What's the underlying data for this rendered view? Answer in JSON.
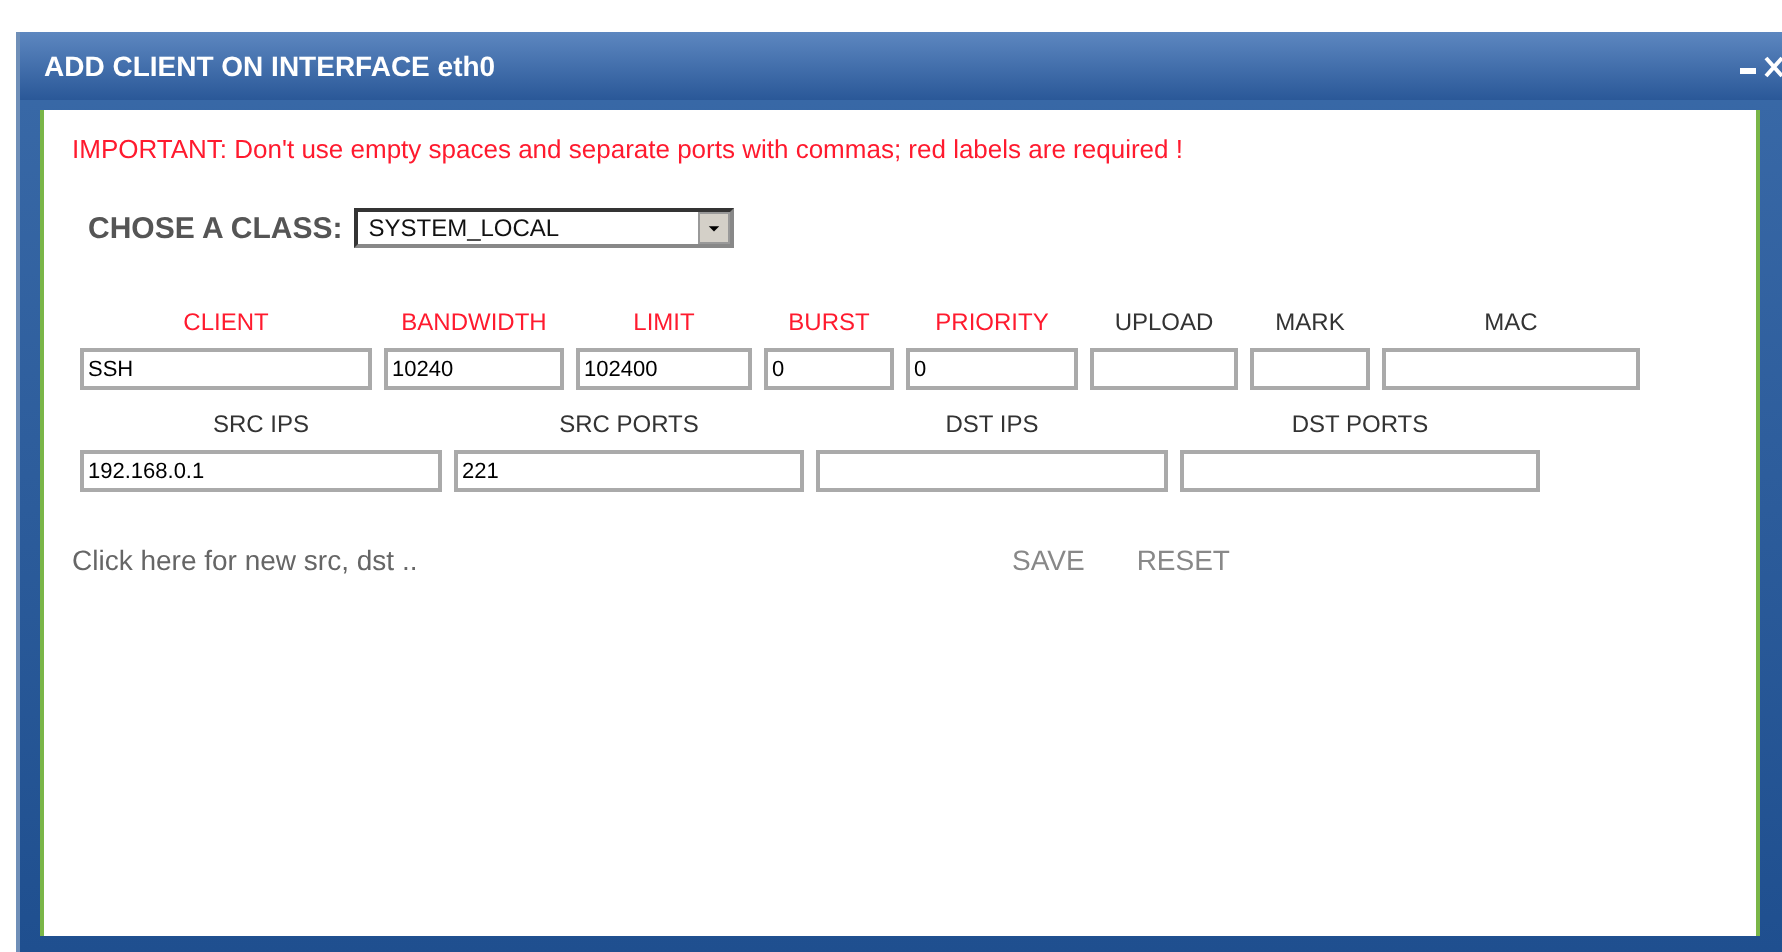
{
  "window": {
    "title": "ADD CLIENT ON INTERFACE eth0"
  },
  "notice": "IMPORTANT: Don't use empty spaces and separate ports with commas; red labels are required !",
  "class_select": {
    "label": "CHOSE A CLASS:",
    "value": "SYSTEM_LOCAL"
  },
  "field_rows": [
    [
      {
        "label": "CLIENT",
        "value": "SSH",
        "required": true
      },
      {
        "label": "BANDWIDTH",
        "value": "10240",
        "required": true
      },
      {
        "label": "LIMIT",
        "value": "102400",
        "required": true
      },
      {
        "label": "BURST",
        "value": "0",
        "required": true
      },
      {
        "label": "PRIORITY",
        "value": "0",
        "required": true
      },
      {
        "label": "UPLOAD",
        "required": false
      },
      {
        "label": "MARK",
        "required": false
      },
      {
        "label": "MAC",
        "required": false
      }
    ],
    [
      {
        "label": "SRC IPS",
        "value": "192.168.0.1",
        "required": false
      },
      {
        "label": "SRC PORTS",
        "value": "221",
        "required": false
      },
      {
        "label": "DST IPS",
        "required": false
      },
      {
        "label": "DST PORTS",
        "required": false
      }
    ]
  ],
  "more_link": "Click here for new src, dst ..",
  "buttons": [
    "SAVE",
    "RESET"
  ]
}
